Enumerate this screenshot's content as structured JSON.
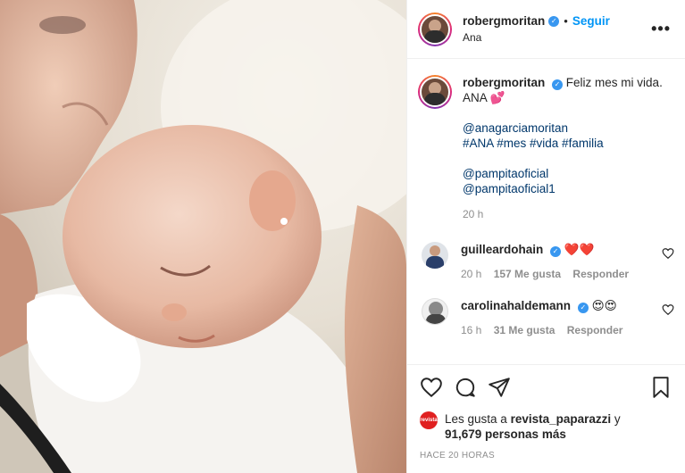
{
  "header": {
    "username": "robergmoritan",
    "verified": true,
    "follow_label": "Seguir",
    "location": "Ana",
    "more_icon": "ellipsis-icon"
  },
  "caption": {
    "username": "robergmoritan",
    "text_line1": "Feliz mes mi vida.",
    "text_line2": "ANA 💕",
    "mention1": "@anagarciamoritan",
    "hashtags": "#ANA #mes #vida #familia",
    "mention2": "@pampitaoficial",
    "mention3": "@pampitaoficial1",
    "time": "20 h"
  },
  "comments": [
    {
      "username": "guilleardohain",
      "verified": true,
      "text": "❤️❤️",
      "time": "20 h",
      "likes": "157 Me gusta",
      "reply": "Responder"
    },
    {
      "username": "carolinahaldemann",
      "verified": true,
      "text": "😍😍",
      "time": "16 h",
      "likes": "31 Me gusta",
      "reply": "Responder"
    }
  ],
  "likes": {
    "avatar_label": "revista",
    "prefix": "Les gusta a ",
    "user": "revista_paparazzi",
    "connector": " y",
    "count": "91,679 personas más"
  },
  "posted": "HACE 20 HORAS",
  "colors": {
    "accent": "#0095f6",
    "verified": "#3897f0",
    "muted": "#8e8e8e",
    "text": "#262626",
    "link": "#00376b"
  }
}
